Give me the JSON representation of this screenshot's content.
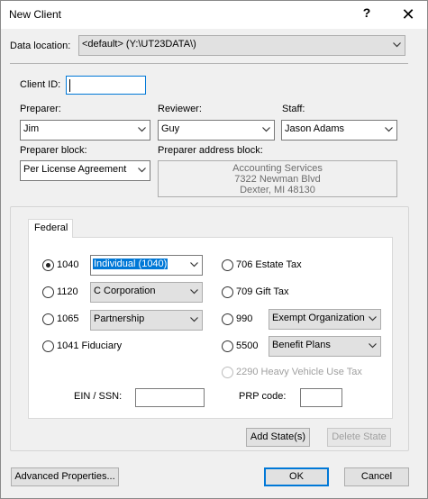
{
  "window": {
    "title": "New Client",
    "help_glyph": "?",
    "close_glyph": "✕"
  },
  "data_location": {
    "label": "Data location:",
    "value": "<default> (Y:\\UT23DATA\\)"
  },
  "client_id": {
    "label": "Client ID:",
    "value": ""
  },
  "preparer": {
    "label": "Preparer:",
    "value": "Jim"
  },
  "reviewer": {
    "label": "Reviewer:",
    "value": "Guy"
  },
  "staff": {
    "label": "Staff:",
    "value": "Jason Adams"
  },
  "preparer_block": {
    "label": "Preparer block:",
    "value": "Per License Agreement"
  },
  "preparer_address": {
    "label": "Preparer address block:",
    "lines": [
      "Accounting Services",
      "7322 Newman Blvd",
      "Dexter, MI 48130"
    ]
  },
  "tab": {
    "label": "Federal"
  },
  "returns": {
    "r1040": {
      "label": "1040",
      "entity": "Individual (1040)",
      "checked": true
    },
    "r1120": {
      "label": "1120",
      "entity": "C Corporation"
    },
    "r1065": {
      "label": "1065",
      "entity": "Partnership"
    },
    "r1041": {
      "label": "1041 Fiduciary"
    },
    "r706": {
      "label": "706 Estate Tax"
    },
    "r709": {
      "label": "709 Gift Tax"
    },
    "r990": {
      "label": "990",
      "entity": "Exempt Organization"
    },
    "r5500": {
      "label": "5500",
      "entity": "Benefit Plans"
    },
    "r2290": {
      "label": "2290 Heavy Vehicle Use Tax",
      "disabled": true
    }
  },
  "ein": {
    "label": "EIN / SSN:",
    "value": ""
  },
  "prp": {
    "label": "PRP code:",
    "value": ""
  },
  "buttons": {
    "add_states": "Add State(s)",
    "delete_state": "Delete State",
    "advanced": "Advanced Properties...",
    "ok": "OK",
    "cancel": "Cancel"
  },
  "colors": {
    "selection": "#0078d7",
    "dialog_bg": "#f0f0f0"
  }
}
